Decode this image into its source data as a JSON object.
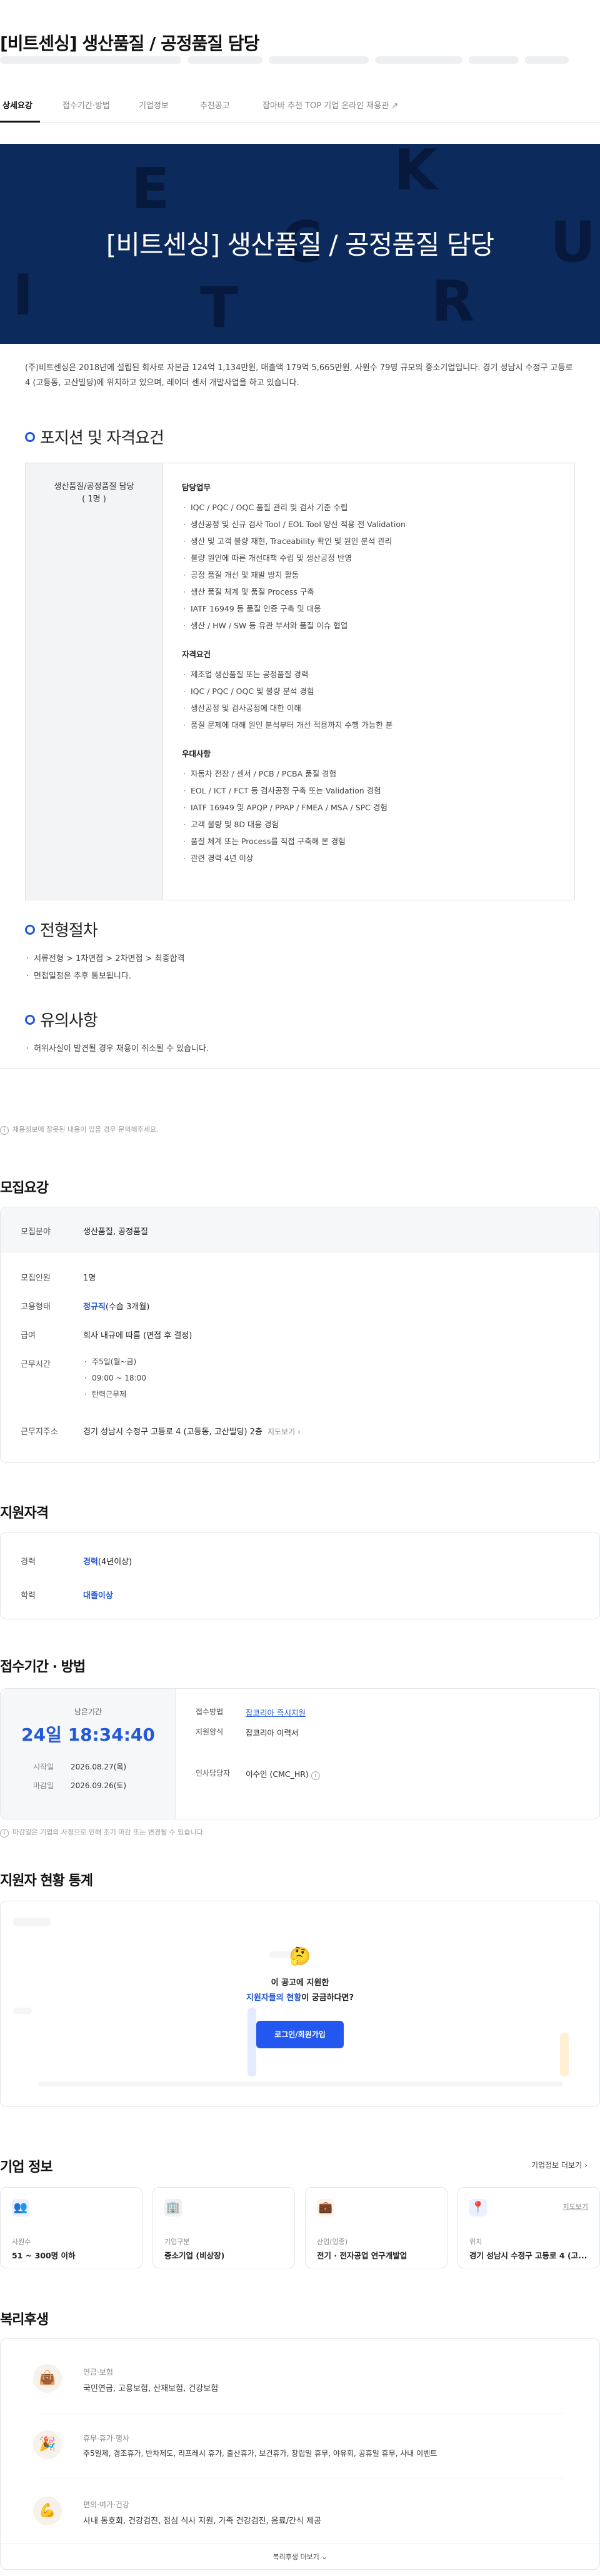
{
  "title": "[비트센싱] 생산품질 / 공정품질 담당",
  "tabs": [
    "상세요강",
    "접수기간·방법",
    "기업정보",
    "추천공고",
    "잡아바 추천 TOP 기업 온라인 채용관"
  ],
  "hero": {
    "title": "[비트센싱] 생산품질 / 공정품질 담당",
    "letters": [
      "E",
      "K",
      "C",
      "U",
      "I",
      "R",
      "T"
    ]
  },
  "intro": "(주)비트센싱은 2018년에 설립된 회사로 자본금 124억 1,134만원, 매출액 179억 5,665만원, 사원수 79명 규모의 중소기업입니다. 경기 성남시 수정구 고등로 4 (고등동, 고산빌딩)에 위치하고 있으며, 레이더 센서 개발사업을 하고 있습니다.",
  "section_position": {
    "heading": "포지션 및 자격요건",
    "job": "생산품질/공정품질 담당",
    "count": "( 1명 )",
    "groups": [
      {
        "title": "담당업무",
        "items": [
          "IQC / PQC / OQC 품질 관리 및 검사 기준 수립",
          "생산공정 및 신규 검사 Tool / EOL Tool 양산 적용 전 Validation",
          "생산 및 고객 불량 재현, Traceability 확인 및 원인 분석 관리",
          "불량 원인에 따른 개선대책 수립 및 생산공정 반영",
          "공정 품질 개선 및 재발 방지 활동",
          "생산 품질 체계 및 품질 Process 구축",
          "IATF 16949 등 품질 인증 구축 및 대응",
          "생산 / HW / SW 등 유관 부서와 품질 이슈 협업"
        ]
      },
      {
        "title": "자격요건",
        "items": [
          "제조업 생산품질 또는 공정품질 경력",
          "IQC / PQC / OQC 및 불량 분석 경험",
          "생산공정 및 검사공정에 대한 이해",
          "품질 문제에 대해 원인 분석부터 개선 적용까지 수행 가능한 분"
        ]
      },
      {
        "title": "우대사항",
        "items": [
          "자동차 전장 / 센서 / PCB / PCBA 품질 경험",
          "EOL / ICT / FCT 등 검사공정 구축 또는 Validation 경험",
          "IATF 16949 및 APQP / PPAP / FMEA / MSA / SPC 경험",
          "고객 불량 및 8D 대응 경험",
          "품질 체계 또는 Process를 직접 구축해 본 경험",
          "관련 경력 4년 이상"
        ]
      }
    ]
  },
  "section_process": {
    "heading": "전형절차",
    "items": [
      "서류전형 > 1차면접 > 2차면접 > 최종합격",
      "면접일정은 추후 통보됩니다."
    ]
  },
  "section_caution": {
    "heading": "유의사항",
    "items": [
      "허위사실이 발견될 경우 채용이 취소될 수 있습니다."
    ]
  },
  "notice1": "채용정보에 잘못된 내용이 있을 경우 문의해주세요.",
  "recruit": {
    "heading": "모집요강",
    "field_label": "모집분야",
    "field_value": "생산품질, 공정품질",
    "headcount_label": "모집인원",
    "headcount_value": "1명",
    "type_label": "고용형태",
    "type_value": "정규직",
    "type_extra": "(수습 3개월)",
    "salary_label": "급여",
    "salary_value": "회사 내규에 따름 (면접 후 결정)",
    "hours_label": "근무시간",
    "hours_items": [
      "주5일(월~금)",
      "09:00 ~ 18:00",
      "탄력근무제"
    ],
    "address_label": "근무지주소",
    "address_value": "경기 성남시 수정구 고등로 4 (고등동, 고산빌딩) 2층",
    "map_link": "지도보기"
  },
  "qualify": {
    "heading": "지원자격",
    "career_label": "경력",
    "career_value": "경력",
    "career_extra": "(4년이상)",
    "edu_label": "학력",
    "edu_value": "대졸이상"
  },
  "apply": {
    "heading": "접수기간 · 방법",
    "remain_label": "남은기간",
    "remain_value": "24일 18:34:40",
    "start_label": "시작일",
    "start_value": "2026.08.27(목)",
    "end_label": "마감일",
    "end_value": "2026.09.26(토)",
    "method_label": "접수방법",
    "method_value": "잡코리아 즉시지원",
    "form_label": "지원양식",
    "form_value": "잡코리아 이력서",
    "manager_label": "인사담당자",
    "manager_value": "이수인 (CMC_HR)",
    "notice": "마감일은 기업의 사정으로 인해 조기 마감 또는 변경될 수 있습니다."
  },
  "stats": {
    "heading": "지원자 현황 통계",
    "line1": "이 공고에 지원한",
    "line2_blue": "지원자들의 현황",
    "line2_rest": "이 궁금하다면?",
    "button": "로그인/회원가입"
  },
  "company": {
    "heading": "기업 정보",
    "more": "기업정보 더보기",
    "cards": [
      {
        "icon": "people-icon",
        "label": "사원수",
        "value": "51 ~ 300명 이하",
        "link": ""
      },
      {
        "icon": "building-icon",
        "label": "기업구분",
        "value": "중소기업 (비상장)",
        "link": ""
      },
      {
        "icon": "briefcase-icon",
        "label": "산업(업종)",
        "value": "전기 · 전자공업 연구개발업",
        "link": ""
      },
      {
        "icon": "location-icon",
        "label": "위치",
        "value": "경기 성남시 수정구 고등로 4 (고...",
        "link": "지도보기"
      }
    ]
  },
  "welfare": {
    "heading": "복리후생",
    "items": [
      {
        "icon": "bag-icon",
        "title": "연금·보험",
        "value": "국민연금, 고용보험, 산재보험, 건강보험"
      },
      {
        "icon": "party-icon",
        "title": "휴무·휴가·행사",
        "value": "주5일제, 경조휴가, 반차제도, 리프레시 휴가, 출산휴가, 보건휴가, 창립일 휴무, 야유회, 공휴일 휴무, 사내 이벤트"
      },
      {
        "icon": "muscle-icon",
        "title": "편의·여가·건강",
        "value": "사내 동호회, 건강검진, 점심 식사 지원, 가족 건강검진, 음료/간식 제공"
      }
    ],
    "more": "복리후생 더보기"
  },
  "colors": {
    "accent": "#2358d6",
    "hero": "#0c2a5b"
  }
}
